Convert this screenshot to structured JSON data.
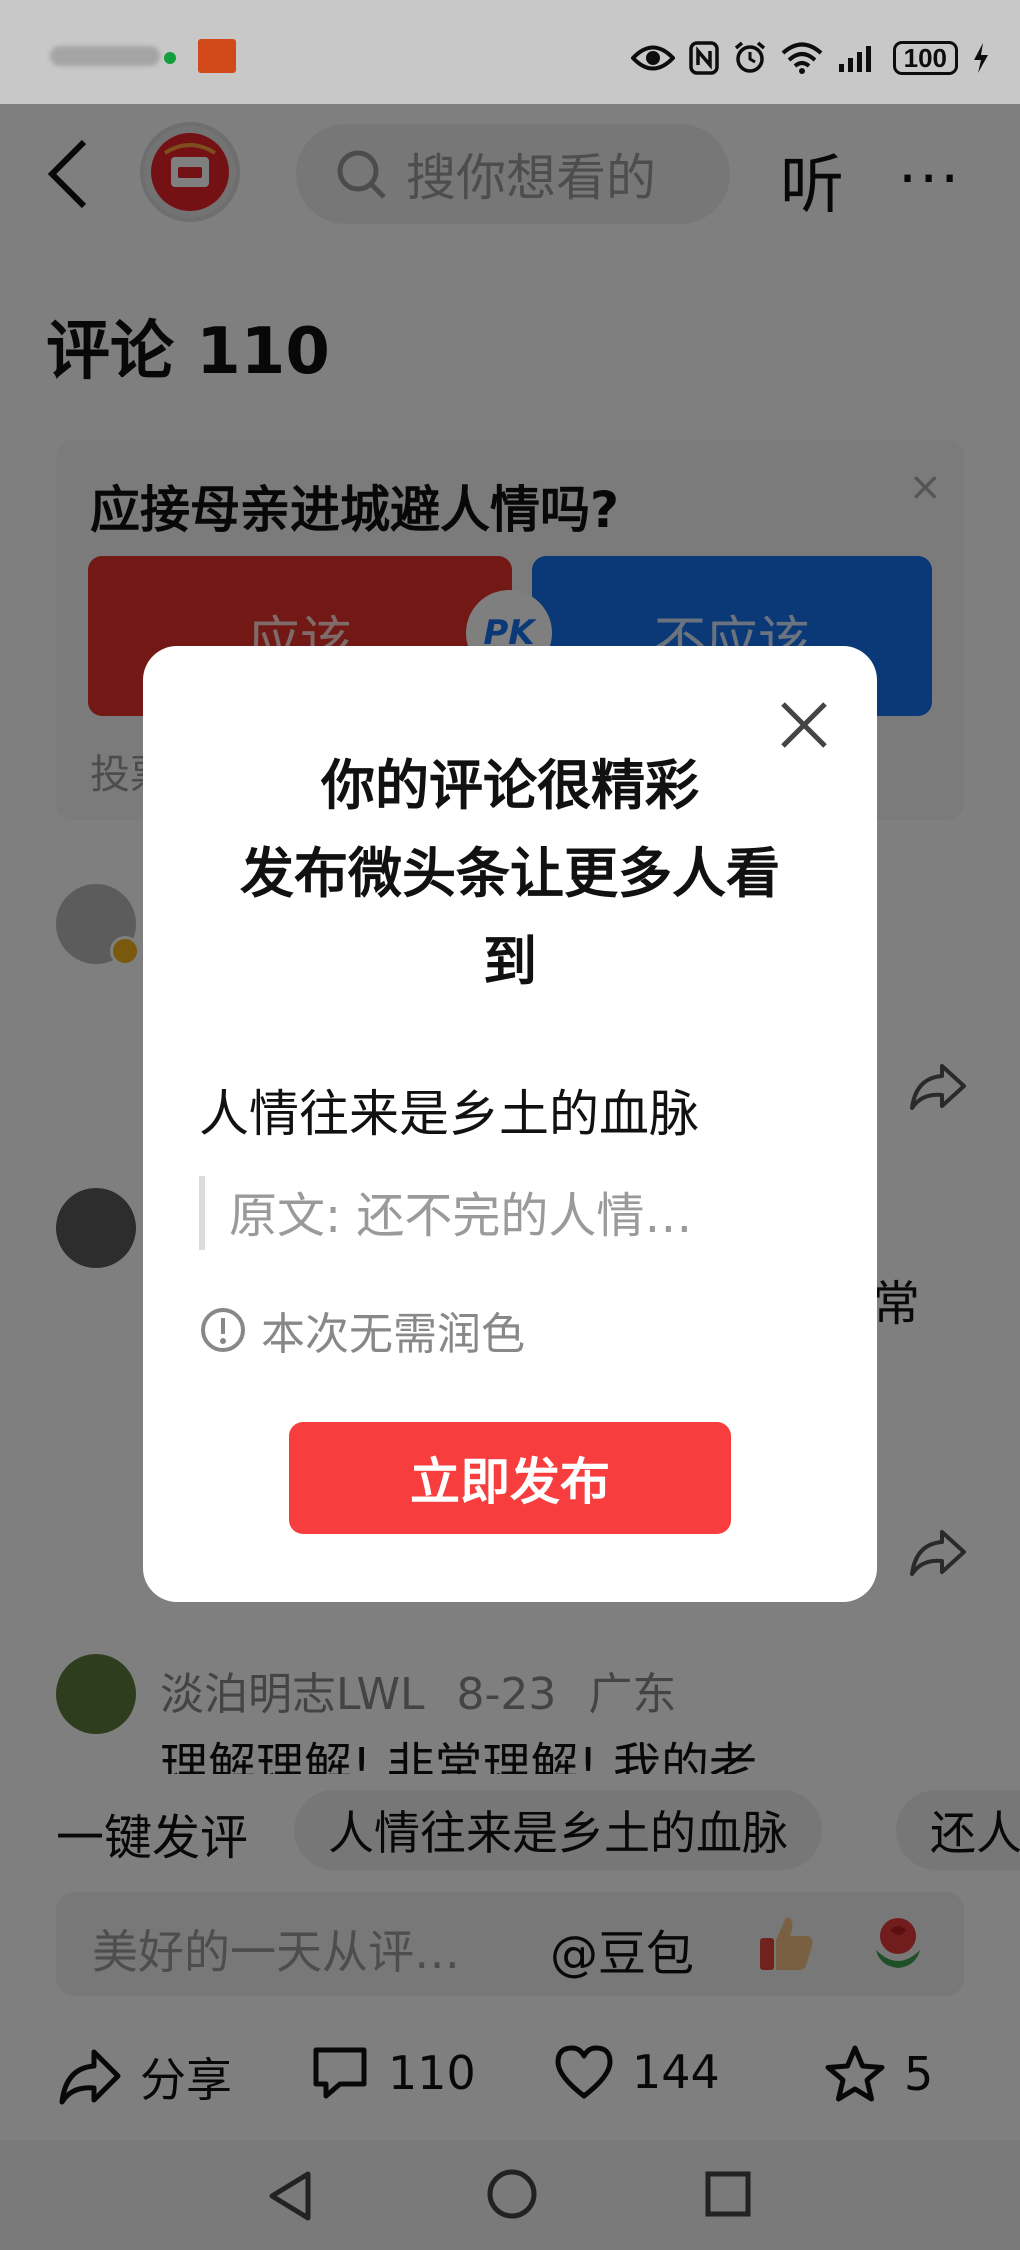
{
  "status_bar": {
    "battery": "100"
  },
  "header": {
    "search_placeholder": "搜你想看的",
    "listen_label": "听",
    "more_label": "···"
  },
  "comments": {
    "title": "评论 110"
  },
  "vote": {
    "question": "应接母亲进城避人情吗?",
    "yes_label": "应该",
    "no_label": "不应该",
    "pk_label": "PK",
    "footer": "投票",
    "close_label": "×"
  },
  "comment_list": [
    {
      "snippet": "常"
    },
    {
      "username": "淡泊明志LWL",
      "date": "8-23",
      "location": "广东",
      "text": "理解理解! 非常理解! 我的老"
    }
  ],
  "quick_comment": {
    "label": "一键发评",
    "chips": [
      "人情往来是乡土的血脉",
      "还人"
    ]
  },
  "comment_input": {
    "placeholder": "美好的一天从评…",
    "mention": "@豆包"
  },
  "actions": {
    "share": "分享",
    "comments": "110",
    "likes": "144",
    "favorites": "5"
  },
  "modal": {
    "title_lines": [
      "你的评论很精彩",
      "发布微头条让更多人看",
      "到"
    ],
    "post_text": "人情往来是乡土的血脉",
    "quote_text": "原文: 还不完的人情…",
    "hint": "本次无需润色",
    "publish_label": "立即发布"
  }
}
